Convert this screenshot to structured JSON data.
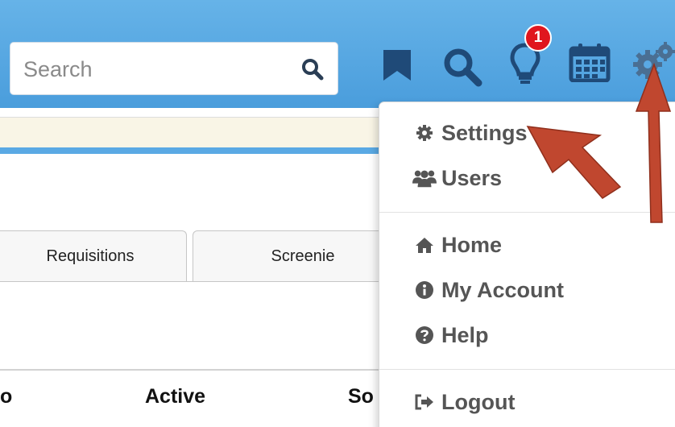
{
  "search": {
    "placeholder": "Search"
  },
  "notifications": {
    "count": "1"
  },
  "icons": {
    "search": "search-icon",
    "bookmark": "bookmark-icon",
    "magnifier": "magnifier-icon",
    "lightbulb": "lightbulb-icon",
    "calendar": "calendar-icon",
    "gears": "gears-icon"
  },
  "tabs": [
    {
      "label": "Requisitions"
    },
    {
      "label": "Screenie"
    }
  ],
  "table": {
    "columns": [
      "o",
      "Active",
      "So"
    ]
  },
  "menu": {
    "items": [
      {
        "label": "Settings",
        "icon": "gear-icon"
      },
      {
        "label": "Users",
        "icon": "users-icon"
      },
      {
        "label": "Home",
        "icon": "home-icon"
      },
      {
        "label": "My Account",
        "icon": "info-circle-icon"
      },
      {
        "label": "Help",
        "icon": "question-circle-icon"
      },
      {
        "label": "Logout",
        "icon": "sign-out-icon"
      }
    ]
  },
  "colors": {
    "topbar": "#4a9ddc",
    "icon_navy": "#1f4a78",
    "badge": "#e0161e",
    "arrow": "#c0472f"
  }
}
